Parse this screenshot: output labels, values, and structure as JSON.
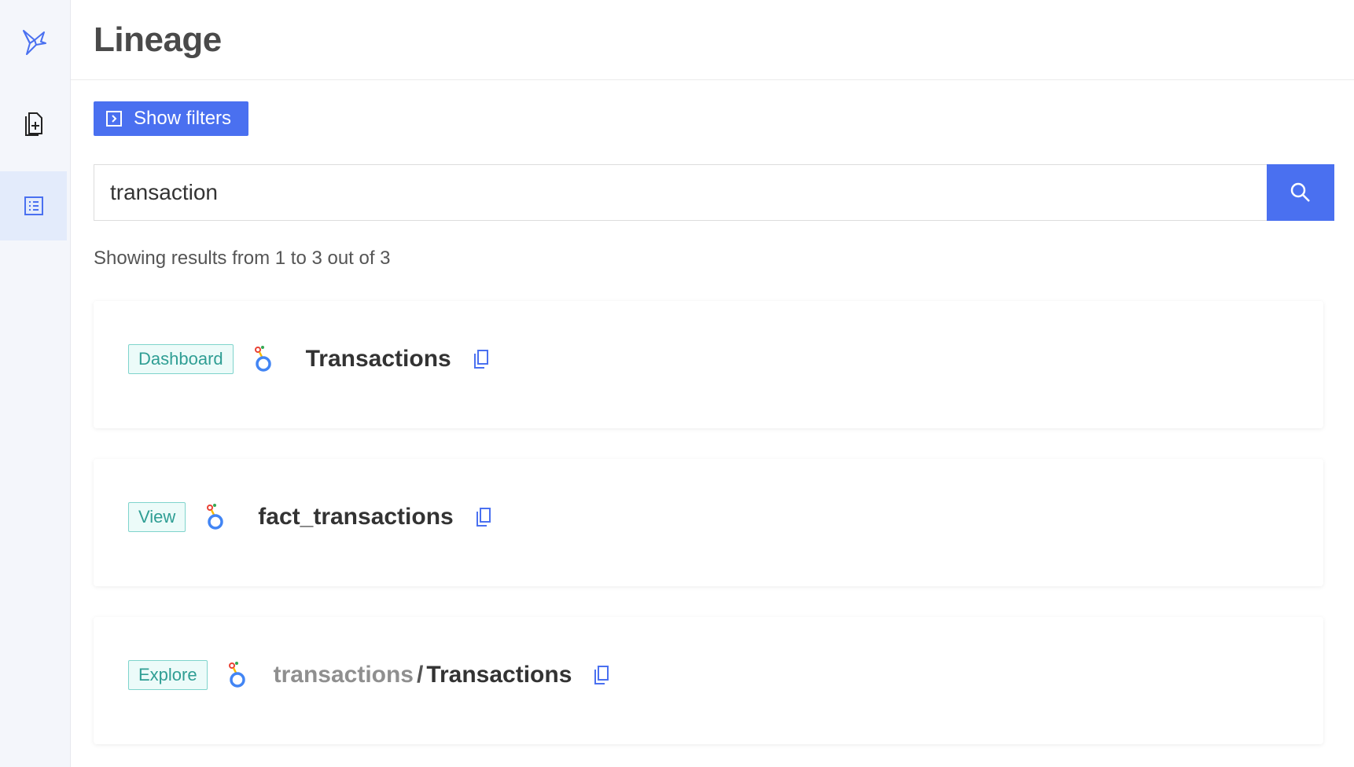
{
  "header": {
    "title": "Lineage"
  },
  "sidebar": {
    "items": [
      {
        "icon": "origami-bird-logo-icon"
      },
      {
        "icon": "document-plus-icon"
      },
      {
        "icon": "list-icon",
        "active": true
      }
    ]
  },
  "filters": {
    "label": "Show filters",
    "icon": "expand-panel-icon"
  },
  "search": {
    "value": "transaction",
    "icon": "search-icon"
  },
  "results": {
    "summary": "Showing results from 1 to 3 out of 3"
  },
  "items": [
    {
      "tag": "Dashboard",
      "prefix": "",
      "sep": "",
      "name": "Transactions"
    },
    {
      "tag": "View",
      "prefix": "",
      "sep": "",
      "name": "fact_transactions"
    },
    {
      "tag": "Explore",
      "prefix": "transactions",
      "sep": "/",
      "name": "Transactions"
    }
  ],
  "colors": {
    "accent": "#4a70f0",
    "tag_border": "#7fd4cc",
    "tag_text": "#2f9e94",
    "sidebar_bg": "#f4f6fb",
    "sidebar_active": "#e3ebfb"
  }
}
